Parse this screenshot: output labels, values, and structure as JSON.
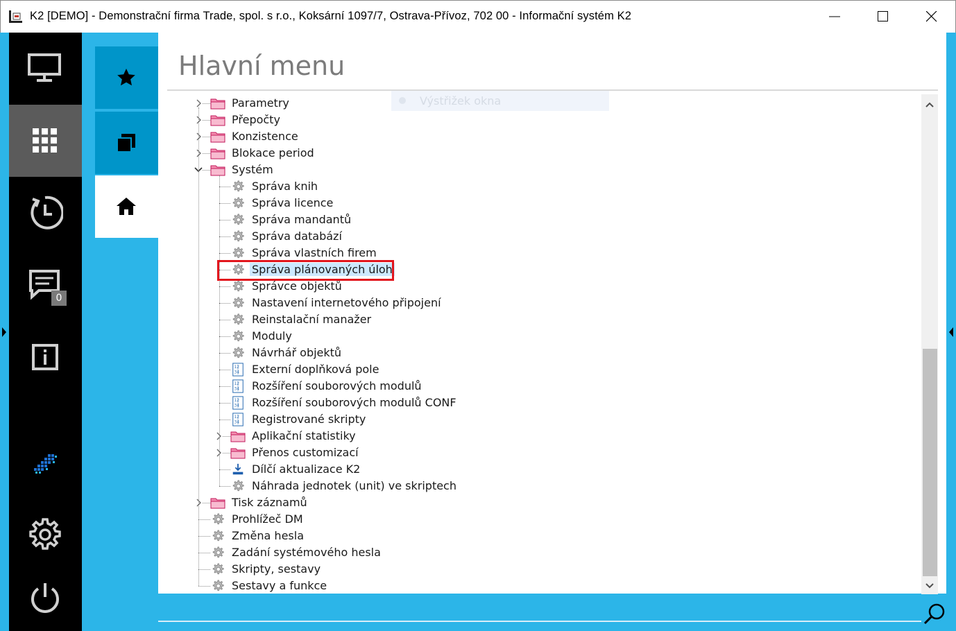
{
  "window": {
    "title": "K2 [DEMO] - Demonstrační firma Trade, spol. s r.o., Koksární 1097/7, Ostrava-Přívoz, 702 00 - Informační systém K2"
  },
  "sidebar": {
    "items": [
      {
        "icon": "monitor-icon"
      },
      {
        "icon": "apps-grid-icon",
        "active": true
      },
      {
        "icon": "history-icon"
      },
      {
        "icon": "messages-icon",
        "badge": "0"
      },
      {
        "icon": "info-icon"
      },
      {
        "icon": "k2-logo-icon"
      },
      {
        "icon": "gear-icon"
      },
      {
        "icon": "power-icon"
      }
    ]
  },
  "tabs": [
    {
      "icon": "star-icon"
    },
    {
      "icon": "windows-icon"
    },
    {
      "icon": "home-icon",
      "active": true
    }
  ],
  "main": {
    "title": "Hlavní menu",
    "ghost_tooltip": "Výstřižek okna"
  },
  "tree": {
    "root": [
      {
        "label": "Parametry",
        "type": "folder",
        "expanded": false
      },
      {
        "label": "Přepočty",
        "type": "folder",
        "expanded": false
      },
      {
        "label": "Konzistence",
        "type": "folder",
        "expanded": false
      },
      {
        "label": "Blokace period",
        "type": "folder",
        "expanded": false
      },
      {
        "label": "Systém",
        "type": "folder",
        "expanded": true
      },
      {
        "label": "Tisk záznamů",
        "type": "folder",
        "expanded": false
      },
      {
        "label": "Prohlížeč DM",
        "type": "gear"
      },
      {
        "label": "Změna hesla",
        "type": "gear"
      },
      {
        "label": "Zadání systémového hesla",
        "type": "gear"
      },
      {
        "label": "Skripty, sestavy",
        "type": "gear"
      },
      {
        "label": "Sestavy a funkce",
        "type": "gear"
      }
    ],
    "system_children": [
      {
        "label": "Správa knih",
        "type": "gear"
      },
      {
        "label": "Správa licence",
        "type": "gear"
      },
      {
        "label": "Správa mandantů",
        "type": "gear"
      },
      {
        "label": "Správa databází",
        "type": "gear"
      },
      {
        "label": "Správa vlastních firem",
        "type": "gear"
      },
      {
        "label": "Správa plánovaných úloh",
        "type": "gear",
        "selected": true
      },
      {
        "label": "Správce objektů",
        "type": "gear"
      },
      {
        "label": "Nastavení internetového připojení",
        "type": "gear"
      },
      {
        "label": "Reinstalační manažer",
        "type": "gear"
      },
      {
        "label": "Moduly",
        "type": "gear"
      },
      {
        "label": "Návrhář objektů",
        "type": "gear"
      },
      {
        "label": "Externí doplňková pole",
        "type": "numdoc"
      },
      {
        "label": "Rozšíření souborových modulů",
        "type": "numdoc"
      },
      {
        "label": "Rozšíření souborových modulů CONF",
        "type": "numdoc"
      },
      {
        "label": "Registrované skripty",
        "type": "numdoc"
      },
      {
        "label": "Aplikační statistiky",
        "type": "folder",
        "expanded": false
      },
      {
        "label": "Přenos customizací",
        "type": "folder",
        "expanded": false
      },
      {
        "label": "Dílčí aktualizace K2",
        "type": "download"
      },
      {
        "label": "Náhrada jednotek (unit) ve skriptech",
        "type": "gear"
      }
    ]
  },
  "colors": {
    "accent": "#2cb5e8",
    "tab_dark": "#0095c9",
    "sidebar": "#000000",
    "sidebar_active": "#5b5b5b",
    "selection": "#cce8ff",
    "highlight": "#e2161d"
  }
}
